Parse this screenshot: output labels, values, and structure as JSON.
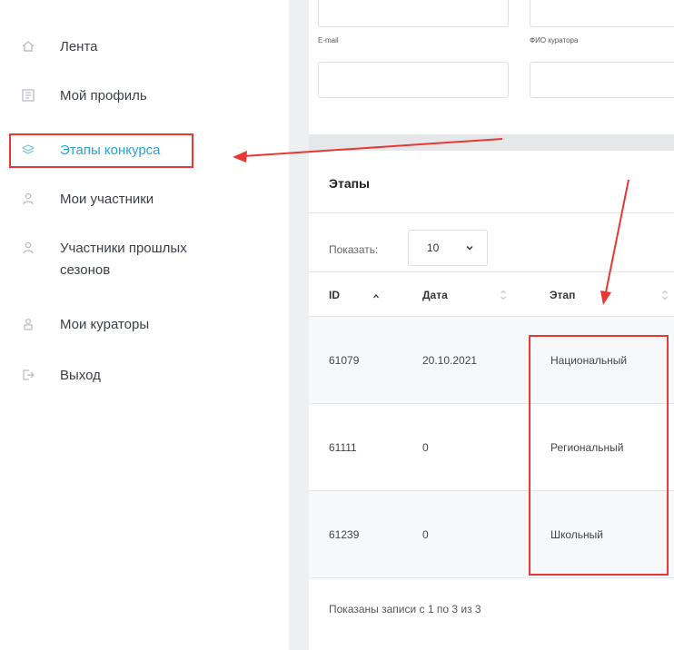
{
  "sidebar": {
    "items": [
      {
        "label": "Лента",
        "icon": "home-icon"
      },
      {
        "label": "Мой профиль",
        "icon": "profile-icon"
      },
      {
        "label": "Этапы конкурса",
        "icon": "layers-icon",
        "active": true
      },
      {
        "label": "Мои участники",
        "icon": "user-icon"
      },
      {
        "label": "Участники прошлых",
        "label2": "сезонов",
        "icon": "user-icon"
      },
      {
        "label": "Мои кураторы",
        "icon": "person-icon"
      },
      {
        "label": "Выход",
        "icon": "logout-icon"
      }
    ]
  },
  "form": {
    "email_label": "E-mail",
    "curator_label": "ФИО куратора"
  },
  "stages": {
    "title": "Этапы",
    "show_label": "Показать:",
    "page_size": "10",
    "columns": [
      "ID",
      "Дата",
      "Этап"
    ],
    "rows": [
      {
        "id": "61079",
        "date": "20.10.2021",
        "stage": "Национальный"
      },
      {
        "id": "61111",
        "date": "0",
        "stage": "Региональный"
      },
      {
        "id": "61239",
        "date": "0",
        "stage": "Школьный"
      }
    ],
    "footer": "Показаны записи с 1 по 3 из 3"
  },
  "colors": {
    "accent": "#29a3d6",
    "annotation": "#e53935"
  }
}
